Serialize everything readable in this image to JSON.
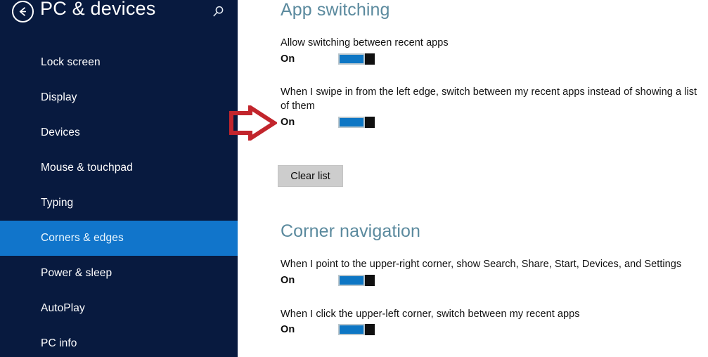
{
  "sidebar": {
    "back_icon": "back-arrow-icon",
    "title": "PC & devices",
    "search_icon": "search-icon",
    "items": [
      {
        "label": "Lock screen",
        "selected": false
      },
      {
        "label": "Display",
        "selected": false
      },
      {
        "label": "Devices",
        "selected": false
      },
      {
        "label": "Mouse & touchpad",
        "selected": false
      },
      {
        "label": "Typing",
        "selected": false
      },
      {
        "label": "Corners & edges",
        "selected": true
      },
      {
        "label": "Power & sleep",
        "selected": false
      },
      {
        "label": "AutoPlay",
        "selected": false
      },
      {
        "label": "PC info",
        "selected": false
      }
    ]
  },
  "content": {
    "sections": [
      {
        "heading": "App switching",
        "settings": [
          {
            "label": "Allow switching between recent apps",
            "state": "On"
          },
          {
            "label": "When I swipe in from the left edge, switch between my recent apps instead of showing a list of them",
            "state": "On"
          }
        ],
        "button": "Clear list"
      },
      {
        "heading": "Corner navigation",
        "settings": [
          {
            "label": "When I point to the upper-right corner, show Search, Share, Start, Devices, and Settings",
            "state": "On"
          },
          {
            "label": "When I click the upper-left corner, switch between my recent apps",
            "state": "On"
          }
        ]
      }
    ]
  },
  "annotation": {
    "icon": "red-right-arrow-annotation",
    "color": "#c2252c"
  },
  "colors": {
    "sidebar_background": "#081a3f",
    "selection_blue": "#1175cb",
    "heading_blue": "#5b8a9e",
    "toggle_on_blue": "#0d76c4",
    "toggle_thumb": "#101010",
    "button_gray": "#cdcdcd"
  }
}
